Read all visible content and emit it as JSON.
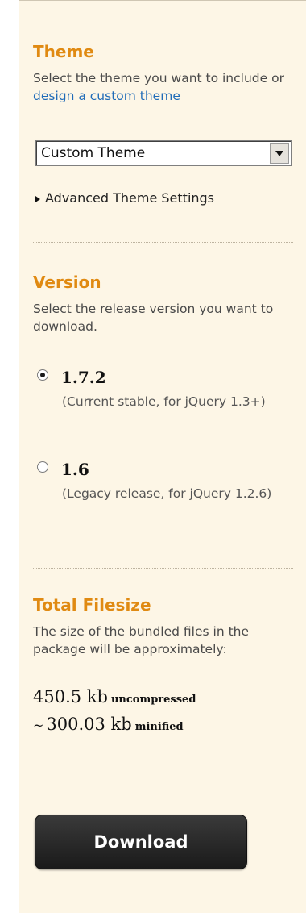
{
  "theme": {
    "title": "Theme",
    "desc_prefix": "Select the theme you want to include or ",
    "desc_link": "design a custom theme",
    "select_value": "Custom Theme",
    "advanced_label": "Advanced Theme Settings"
  },
  "version": {
    "title": "Version",
    "desc": "Select the release version you want to download.",
    "options": [
      {
        "label": "1.7.2",
        "note": "(Current stable, for jQuery 1.3+)",
        "checked": true
      },
      {
        "label": "1.6",
        "note": "(Legacy release, for jQuery 1.2.6)",
        "checked": false
      }
    ]
  },
  "filesize": {
    "title": "Total Filesize",
    "desc": "The size of the bundled files in the package will be approximately:",
    "uncompressed_value": "450.5 kb",
    "uncompressed_suffix": "uncompressed",
    "minified_prefix": "~",
    "minified_value": "300.03 kb",
    "minified_suffix": "minified"
  },
  "download": {
    "label": "Download"
  },
  "colors": {
    "section_title": "#e08a12",
    "panel_bg": "#fdf6e6",
    "link": "#1f6bb8"
  }
}
